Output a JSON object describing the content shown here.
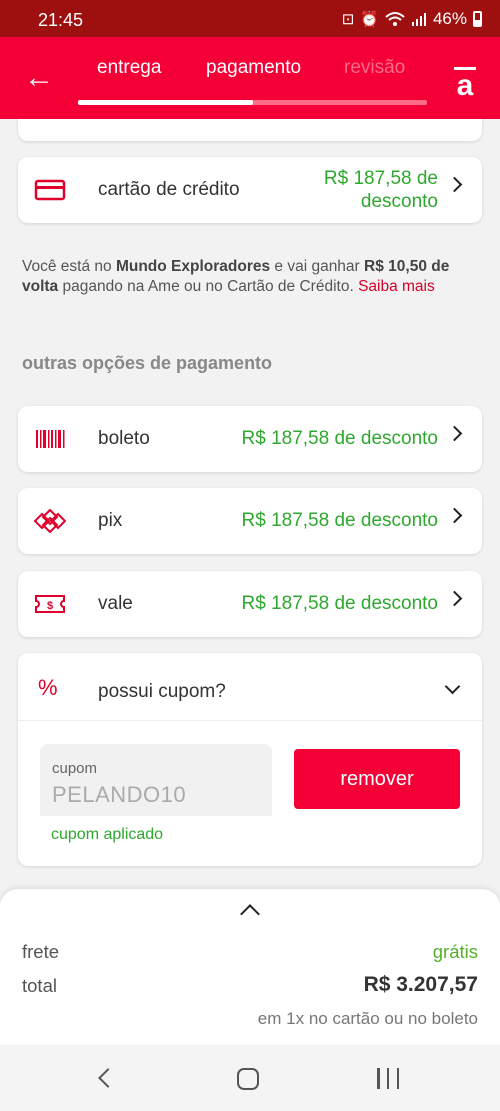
{
  "status_bar": {
    "time": "21:45",
    "battery": "46%"
  },
  "header": {
    "tabs": [
      {
        "label": "entrega"
      },
      {
        "label": "pagamento"
      },
      {
        "label": "revisão"
      }
    ],
    "progress_fraction": 0.5,
    "logo_letter": "a"
  },
  "primary_payment": {
    "label": "cartão de crédito",
    "discount": "R$ 187,58 de desconto"
  },
  "info_text": {
    "part1": "Você está no ",
    "bold1": "Mundo Exploradores",
    "part2": " e vai ganhar ",
    "bold2": "R$ 10,50 de volta",
    "part3": " pagando na Ame ou no Cartão de Crédito. ",
    "link": "Saiba mais"
  },
  "section_title": "outras opções de pagamento",
  "other_payments": [
    {
      "label": "boleto",
      "discount": "R$ 187,58 de desconto",
      "icon": "barcode-icon"
    },
    {
      "label": "pix",
      "discount": "R$ 187,58 de desconto",
      "icon": "pix-icon"
    },
    {
      "label": "vale",
      "discount": "R$ 187,58 de desconto",
      "icon": "voucher-icon"
    }
  ],
  "coupon": {
    "question": "possui cupom?",
    "field_label": "cupom",
    "field_value": "PELANDO10",
    "status": "cupom aplicado",
    "button": "remover"
  },
  "summary": {
    "frete_label": "frete",
    "frete_value": "grátis",
    "total_label": "total",
    "total_value": "R$ 3.207,57",
    "total_sub": "em 1x no cartão ou no boleto"
  },
  "colors": {
    "brand": "#f40037",
    "status_bar": "#9e1010",
    "discount_green": "#2ea82e"
  }
}
